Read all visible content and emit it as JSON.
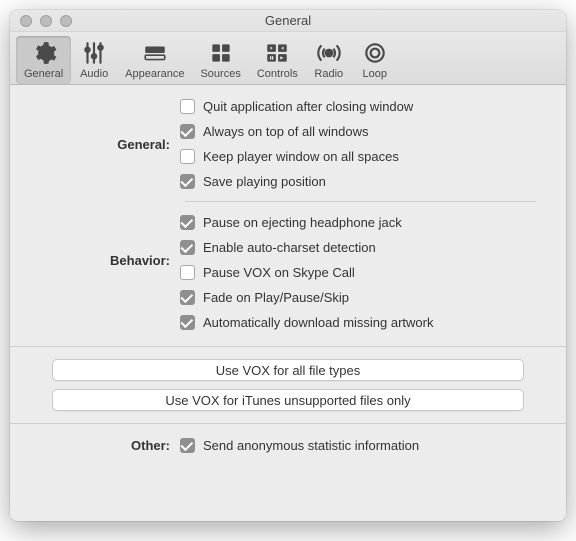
{
  "window": {
    "title": "General"
  },
  "toolbar": {
    "items": [
      {
        "label": "General"
      },
      {
        "label": "Audio"
      },
      {
        "label": "Appearance"
      },
      {
        "label": "Sources"
      },
      {
        "label": "Controls"
      },
      {
        "label": "Radio"
      },
      {
        "label": "Loop"
      }
    ]
  },
  "sections": {
    "general": {
      "label": "General:",
      "options": [
        {
          "label": "Quit application after closing window",
          "checked": false
        },
        {
          "label": "Always on top of all windows",
          "checked": true
        },
        {
          "label": "Keep player window on all spaces",
          "checked": false
        },
        {
          "label": "Save playing position",
          "checked": true
        }
      ]
    },
    "behavior": {
      "label": "Behavior:",
      "options": [
        {
          "label": "Pause on ejecting headphone jack",
          "checked": true
        },
        {
          "label": "Enable auto-charset detection",
          "checked": true
        },
        {
          "label": "Pause VOX on Skype Call",
          "checked": false
        },
        {
          "label": "Fade on Play/Pause/Skip",
          "checked": true
        },
        {
          "label": "Automatically download missing artwork",
          "checked": true
        }
      ]
    },
    "other": {
      "label": "Other:",
      "options": [
        {
          "label": "Send anonymous statistic information",
          "checked": true
        }
      ]
    }
  },
  "buttons": {
    "all_types": "Use VOX for all file types",
    "itunes_unsupported": "Use VOX for iTunes unsupported files only"
  }
}
